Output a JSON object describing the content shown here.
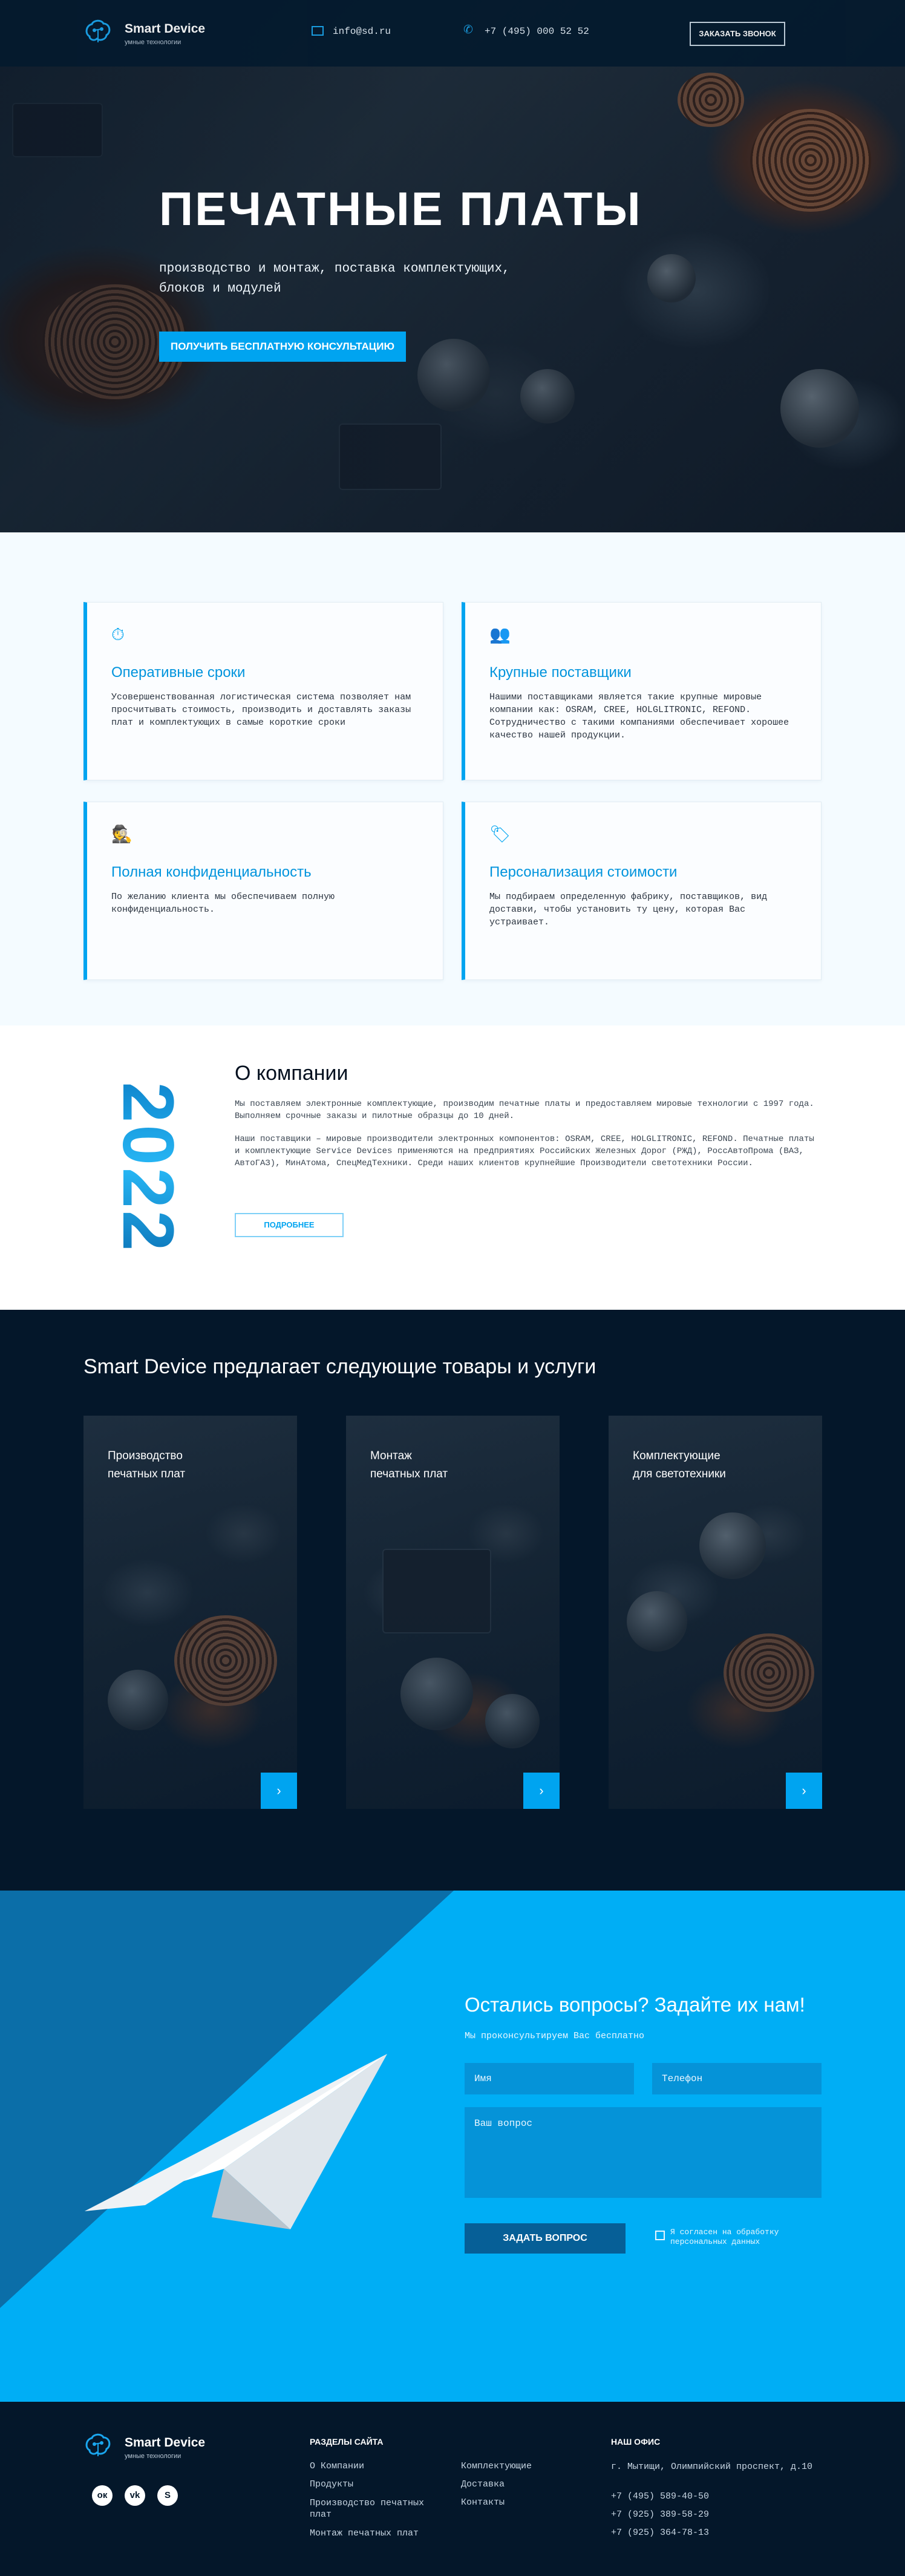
{
  "brand": {
    "name": "Smart Device",
    "tagline": "умные технологии"
  },
  "header": {
    "email": "info@sd.ru",
    "phone": "+7 (495) 000 52 52",
    "callback_button": "ЗАКАЗАТЬ ЗВОНОК"
  },
  "hero": {
    "title": "ПЕЧАТНЫЕ ПЛАТЫ",
    "subtitle_line1": "производство и монтаж, поставка комплектующих,",
    "subtitle_line2": "блоков и модулей",
    "cta": "ПОЛУЧИТЬ БЕСПЛАТНУЮ КОНСУЛЬТАЦИЮ"
  },
  "features": [
    {
      "icon": "stopwatch-icon",
      "title": "Оперативные сроки",
      "text": "Усовершенствованная логистическая система позволяет нам просчитывать стоимость, производить и доставлять заказы плат и комплектующих в самые короткие сроки"
    },
    {
      "icon": "team-icon",
      "title": "Крупные поставщики",
      "text": "Нашими поставщиками является такие крупные мировые компании как: OSRAM, CREE, HOLGLITRONIC, REFOND. Сотрудничество с такими компаниями обеспечивает хорошее качество нашей продукции."
    },
    {
      "icon": "spy-icon",
      "title": "Полная конфиденциальность",
      "text": "По желанию клиента мы обеспечиваем полную конфиденциальность."
    },
    {
      "icon": "price-tag-icon",
      "title": "Персонализация стоимости",
      "text": "Мы подбираем определенную фабрику, поставщиков, вид доставки, чтобы установить ту цену, которая Вас устраивает."
    }
  ],
  "about": {
    "year": "2022",
    "title": "О компании",
    "p1": "Мы поставляем электронные комплектующие, производим печатные платы и предоставляем мировые технологии с 1997 года. Выполняем срочные заказы и пилотные образцы до 10 дней.",
    "p2": "Наши поставщики – мировые производители электронных компонентов: OSRAM, CREE, HOLGLITRONIC, REFOND. Печатные платы и комплектующие Service Devices применяются на предприятиях Российских Железных Дорог (РЖД), РоссАвтоПрома (ВАЗ, АвтоГАЗ), МинАтома, СпецМедТехники. Среди наших клиентов крупнейшие Производители светотехники России.",
    "more_button": "ПОДРОБНЕЕ"
  },
  "services": {
    "title": "Smart Device предлагает следующие товары и услуги",
    "items": [
      {
        "line1": "Производство",
        "line2": "печатных плат"
      },
      {
        "line1": "Монтаж",
        "line2": "печатных плат"
      },
      {
        "line1": "Комплектующие",
        "line2": "для светотехники"
      }
    ],
    "arrow": "›"
  },
  "contact": {
    "title": "Остались вопросы? Задайте их нам!",
    "subtitle": "Мы проконсультируем Вас бесплатно",
    "name_placeholder": "Имя",
    "phone_placeholder": "Телефон",
    "question_placeholder": "Ваш вопрос",
    "submit": "ЗАДАТЬ ВОПРОС",
    "consent_line1": "Я согласен на обработку",
    "consent_line2": "персональных данных"
  },
  "footer": {
    "sections_title": "РАЗДЕЛЫ САЙТА",
    "links_col1": [
      "О Компании",
      "Продукты",
      "Производство печатных плат",
      "Монтаж печатных плат"
    ],
    "links_col2": [
      "Комплектующие",
      "Доставка",
      "Контакты"
    ],
    "office_title": "НАШ ОФИС",
    "address": "г. Мытищи, Олимпийский проспект, д.10",
    "phones": [
      "+7 (495) 589-40-50",
      "+7 (925) 389-58-29",
      "+7 (925) 364-78-13"
    ]
  },
  "colors": {
    "accent": "#00a4f0",
    "dark": "#04172a",
    "light": "#f4fbff"
  }
}
